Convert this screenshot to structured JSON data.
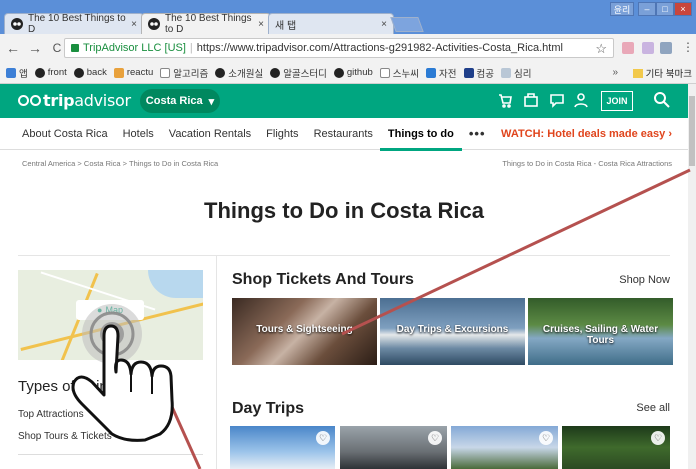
{
  "browser": {
    "tabs": [
      {
        "title": "The 10 Best Things to D",
        "close": "×"
      },
      {
        "title": "The 10 Best Things to D",
        "close": "×"
      },
      {
        "title": "새 탭",
        "close": "×"
      }
    ],
    "window_user": "윤리",
    "window_controls": [
      "–",
      "□",
      "×"
    ],
    "back": "←",
    "forward": "→",
    "reload": "C",
    "secure_label": "TripAdvisor LLC [US]",
    "url": "https://www.tripadvisor.com/Attractions-g291982-Activities-Costa_Rica.html",
    "star": "☆",
    "bookmarks": [
      "앱",
      "front",
      "back",
      "reactu",
      "알고리즘",
      "소개원실",
      "알골스터디",
      "github",
      "스누씨",
      "자전",
      "컴공",
      "심리"
    ],
    "bookmarks_more": "»",
    "bookmarks_folder": "기타 북마크"
  },
  "site": {
    "colors": {
      "brand": "#00a680",
      "watch": "#e0451d"
    },
    "logo": {
      "prefix": "trip",
      "suffix": "advisor"
    },
    "geo_button": "Costa Rica",
    "geo_chevron": "▾",
    "join": "JOIN",
    "nav": [
      "About Costa Rica",
      "Hotels",
      "Vacation Rentals",
      "Flights",
      "Restaurants",
      "Things to do"
    ],
    "nav_more": "•••",
    "watch": "WATCH: Hotel deals made easy ›",
    "breadcrumbs": "Central America  >  Costa Rica  >  Things to Do in Costa Rica",
    "breadcrumbs_right": "Things to Do in Costa Rica - Costa Rica Attractions",
    "page_title": "Things to Do in Costa Rica",
    "map_pill": "Map",
    "types_heading": "Types of Things",
    "side_links": [
      "Top Attractions",
      "Shop Tours & Tickets"
    ],
    "shop_title": "Shop Tickets And Tours",
    "shop_link": "Shop Now",
    "tiles": [
      "Tours & Sightseeing",
      "Day Trips & Excursions",
      "Cruises, Sailing & Water Tours"
    ],
    "day_trips_title": "Day Trips",
    "day_trips_link": "See all",
    "heart": "♡"
  }
}
